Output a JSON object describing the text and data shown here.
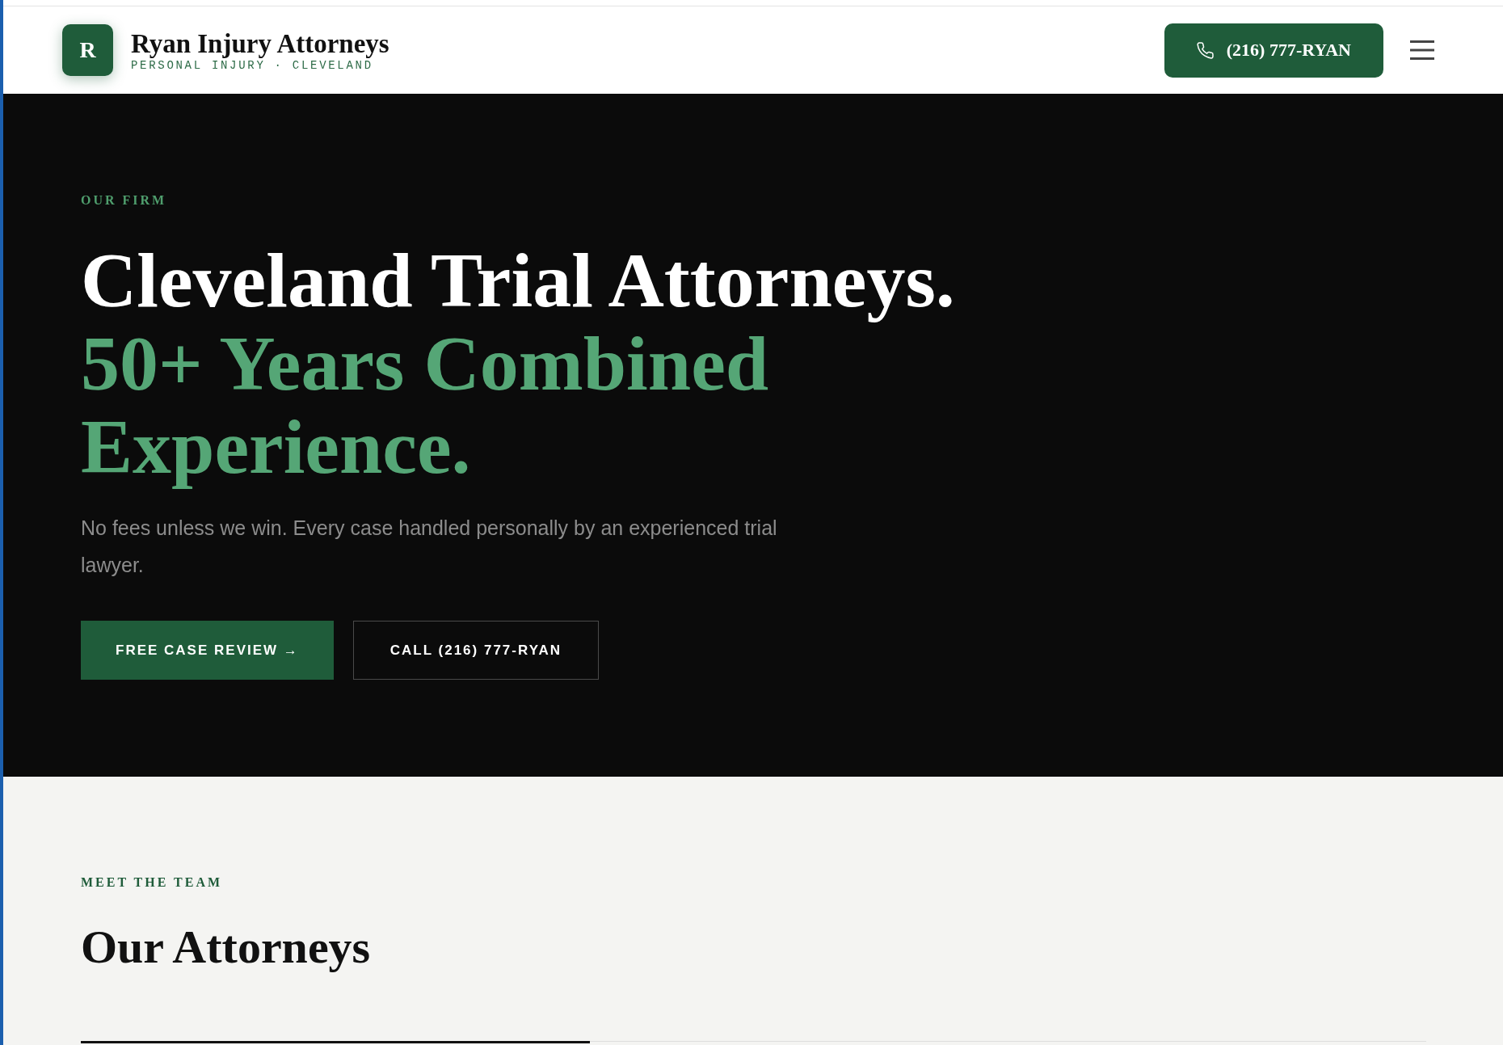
{
  "header": {
    "logo": {
      "letter": "R",
      "title": "Ryan Injury Attorneys",
      "tagline": "PERSONAL INJURY · CLEVELAND"
    },
    "phone_button": "(216) 777-RYAN"
  },
  "hero": {
    "eyebrow": "OUR FIRM",
    "title": "Cleveland Trial Attorneys.",
    "title_accent": "50+ Years Combined Experience.",
    "subtitle": "No fees unless we win. Every case handled personally by an experienced trial lawyer.",
    "buttons": [
      {
        "label": "FREE CASE REVIEW →",
        "kind": "primary"
      },
      {
        "label": "CALL (216) 777-RYAN",
        "kind": "outline"
      }
    ]
  },
  "team": {
    "eyebrow": "MEET THE TEAM",
    "title": "Our Attorneys"
  }
}
